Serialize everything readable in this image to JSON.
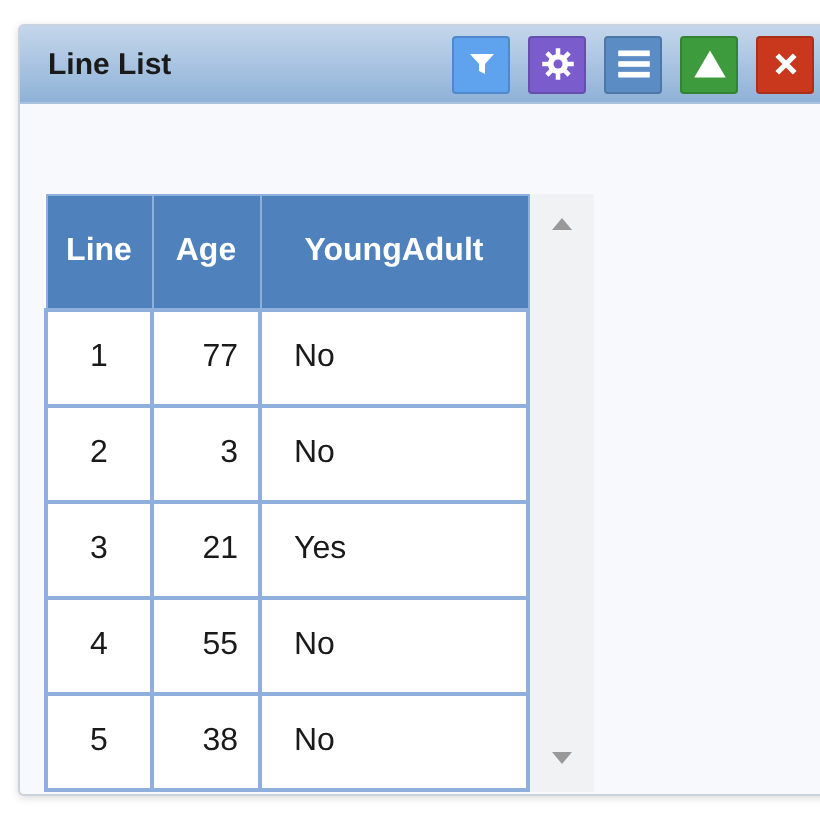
{
  "window": {
    "title": "Line List"
  },
  "toolbar": [
    {
      "kind": "filter"
    },
    {
      "kind": "settings"
    },
    {
      "kind": "menu"
    },
    {
      "kind": "collapse"
    },
    {
      "kind": "close"
    }
  ],
  "table": {
    "columns": [
      "Line",
      "Age",
      "YoungAdult"
    ],
    "rows": [
      [
        "1",
        "77",
        "No"
      ],
      [
        "2",
        "3",
        "No"
      ],
      [
        "3",
        "21",
        "Yes"
      ],
      [
        "4",
        "55",
        "No"
      ],
      [
        "5",
        "38",
        "No"
      ]
    ]
  }
}
